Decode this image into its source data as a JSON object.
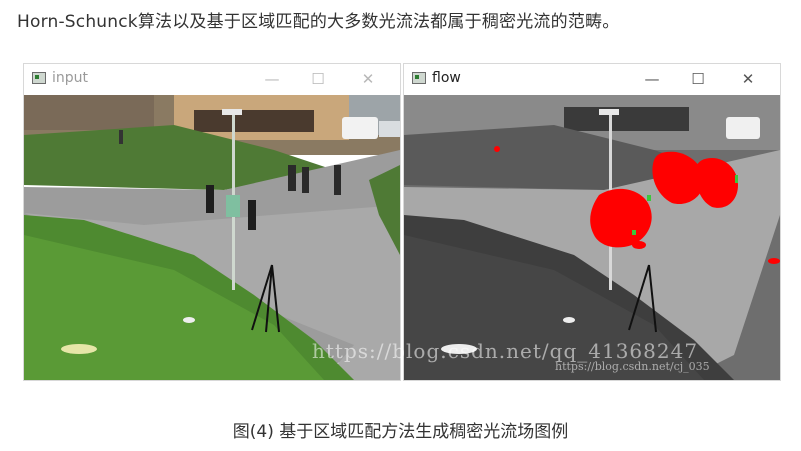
{
  "intro_text": "Horn-Schunck算法以及基于区域匹配的大多数光流法都属于稠密光流的范畴。",
  "windows": [
    {
      "title": "input",
      "icon": "app-window-icon",
      "controls": {
        "minimize": "—",
        "maximize": "☐",
        "close": "✕"
      }
    },
    {
      "title": "flow",
      "icon": "app-window-icon",
      "controls": {
        "minimize": "—",
        "maximize": "☐",
        "close": "✕"
      }
    }
  ],
  "watermark": "https://blog.csdn.net/qq_41368247",
  "watermark_small": "https://blog.csdn.net/cj_035",
  "caption": "图(4) 基于区域匹配方法生成稠密光流场图例",
  "colors": {
    "flow_motion": "#ff0000",
    "flow_edge": "#3cc83c"
  }
}
